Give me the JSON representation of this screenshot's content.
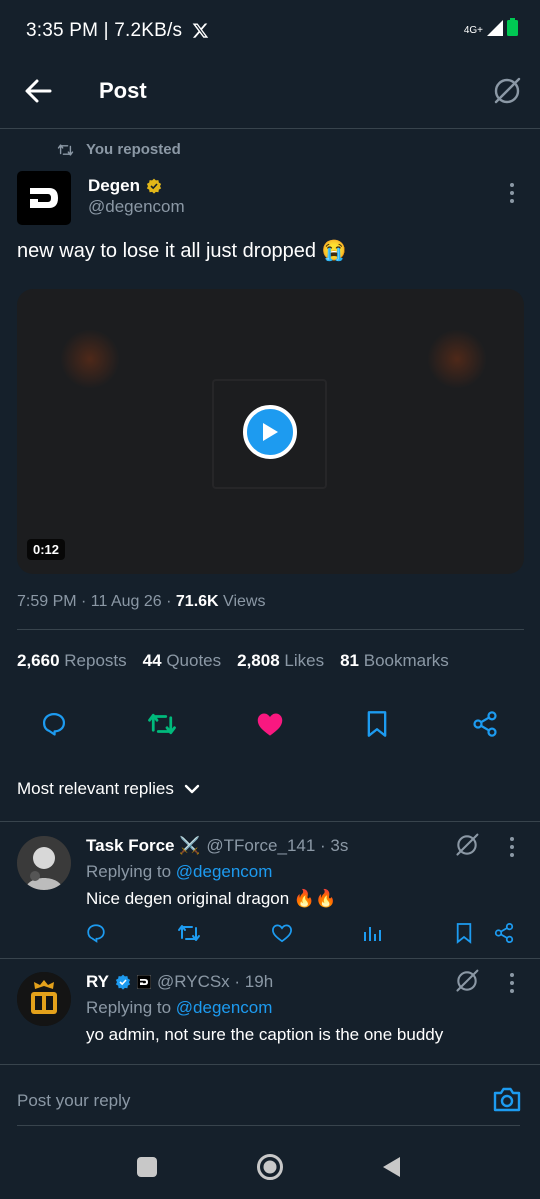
{
  "status_bar": {
    "text": "3:35 PM | 7.2KB/s",
    "network": "4G+"
  },
  "header": {
    "title": "Post"
  },
  "post": {
    "repost_text": "You reposted",
    "author_name": "Degen",
    "author_handle": "@degencom",
    "text": "new way to lose it all just dropped 😭",
    "video_duration": "0:12",
    "time": "7:59 PM · 11 Aug 26 · ",
    "views_count": "71.6K",
    "views_label": " Views",
    "stats": [
      {
        "count": "2,660",
        "label": "Reposts"
      },
      {
        "count": "44",
        "label": "Quotes"
      },
      {
        "count": "2,808",
        "label": "Likes"
      },
      {
        "count": "81",
        "label": "Bookmarks"
      }
    ]
  },
  "replies_sort": {
    "label": "Most relevant replies"
  },
  "replies": [
    {
      "name": "Task Force ⚔️",
      "handle": "@TForce_141 · 3s",
      "replying_prefix": "Replying to ",
      "replying_to": "@degencom",
      "text": "Nice degen original dragon 🔥🔥"
    },
    {
      "name": "RY",
      "handle": "@RYCSx · 19h",
      "replying_prefix": "Replying to ",
      "replying_to": "@degencom",
      "text": "yo admin, not sure the caption is the one buddy"
    }
  ],
  "compose": {
    "placeholder": "Post your reply"
  },
  "colors": {
    "background": "#15202b",
    "accent": "#1d9bf0",
    "repost_green": "#00ba7c",
    "like_pink": "#f91880"
  }
}
